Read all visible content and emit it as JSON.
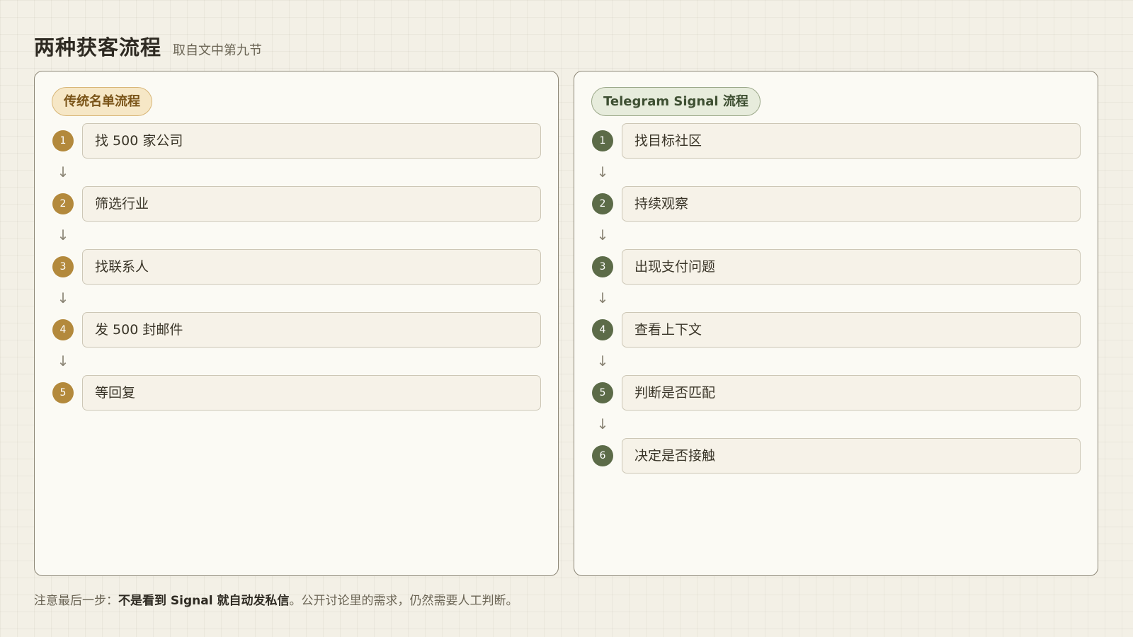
{
  "header": {
    "title": "两种获客流程",
    "subtitle": "取自文中第九节"
  },
  "left_panel": {
    "label": "传统名单流程",
    "accent": "#b3893c",
    "steps": [
      {
        "num": "1",
        "text": "找 500 家公司"
      },
      {
        "num": "2",
        "text": "筛选行业"
      },
      {
        "num": "3",
        "text": "找联系人"
      },
      {
        "num": "4",
        "text": "发 500 封邮件"
      },
      {
        "num": "5",
        "text": "等回复"
      }
    ]
  },
  "right_panel": {
    "label": "Telegram Signal 流程",
    "accent": "#5c6b48",
    "steps": [
      {
        "num": "1",
        "text": "找目标社区"
      },
      {
        "num": "2",
        "text": "持续观察"
      },
      {
        "num": "3",
        "text": "出现支付问题"
      },
      {
        "num": "4",
        "text": "查看上下文"
      },
      {
        "num": "5",
        "text": "判断是否匹配"
      },
      {
        "num": "6",
        "text": "决定是否接触"
      }
    ]
  },
  "arrow_glyph": "↓",
  "footer": {
    "prefix": "注意最后一步：",
    "emphasis": "不是看到 Signal 就自动发私信",
    "suffix": "。公开讨论里的需求，仍然需要人工判断。"
  }
}
